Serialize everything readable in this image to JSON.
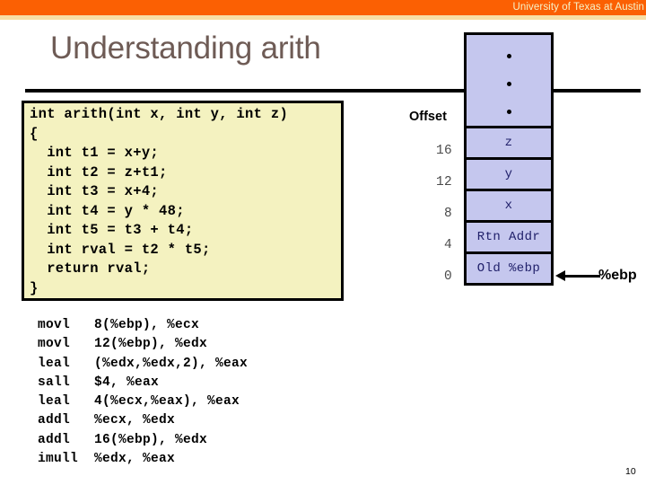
{
  "banner": {
    "title": "University of Texas at Austin",
    "bar_color": "#FB6003",
    "stripe_color": "#F7DFA6",
    "text_color": "#F6F2C8"
  },
  "slide": {
    "title": "Understanding arith",
    "title_color": "#6E5B55",
    "page_number": "10"
  },
  "c_code": {
    "box_fill": "#F4F2C0",
    "text": "int arith(int x, int y, int z)\n{\n  int t1 = x+y;\n  int t2 = z+t1;\n  int t3 = x+4;\n  int t4 = y * 48;\n  int t5 = t3 + t4;\n  int rval = t2 * t5;\n  return rval;\n}"
  },
  "assembly": {
    "text": "movl   8(%ebp), %ecx\nmovl   12(%ebp), %edx\nleal   (%edx,%edx,2), %eax\nsall   $4, %eax\nleal   4(%ecx,%eax), %eax\naddl   %ecx, %edx\naddl   16(%ebp), %edx\nimull  %edx, %eax"
  },
  "stack": {
    "fill_color": "#C5C7EE",
    "text_color": "#20206A",
    "offset_header": "Offset",
    "ellipsis_cell": "...",
    "cells": [
      {
        "offset": "16",
        "label": "z"
      },
      {
        "offset": "12",
        "label": "y"
      },
      {
        "offset": "8",
        "label": "x"
      },
      {
        "offset": "4",
        "label": "Rtn Addr"
      },
      {
        "offset": "0",
        "label": "Old %ebp"
      }
    ],
    "pointer_label": "%ebp"
  }
}
